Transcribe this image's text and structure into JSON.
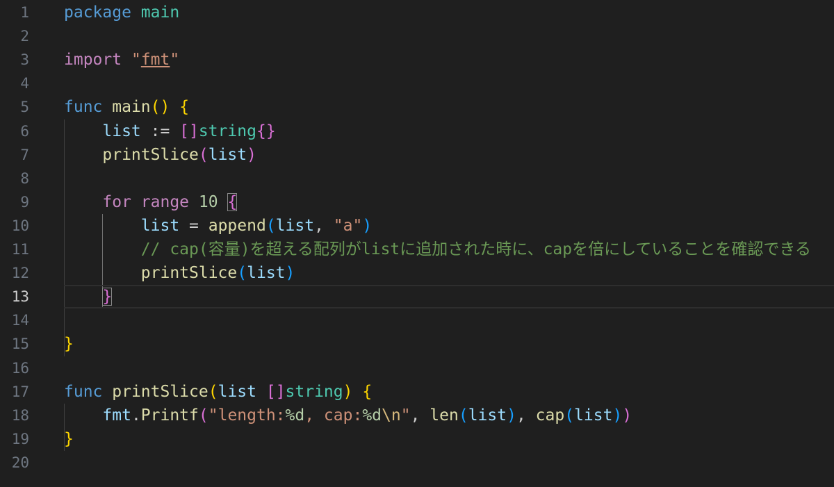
{
  "editor": {
    "language": "go",
    "current_line": 13,
    "line_numbers": [
      "1",
      "2",
      "3",
      "4",
      "5",
      "6",
      "7",
      "8",
      "9",
      "10",
      "11",
      "12",
      "13",
      "14",
      "15",
      "16",
      "17",
      "18",
      "19",
      "20"
    ],
    "lines": [
      [
        [
          "kw",
          "package"
        ],
        [
          "plain",
          " "
        ],
        [
          "type",
          "main"
        ]
      ],
      [],
      [
        [
          "kw2",
          "import"
        ],
        [
          "plain",
          " "
        ],
        [
          "str",
          "\""
        ],
        [
          "str-u",
          "fmt"
        ],
        [
          "str",
          "\""
        ]
      ],
      [],
      [
        [
          "kw",
          "func"
        ],
        [
          "plain",
          " "
        ],
        [
          "fn",
          "main"
        ],
        [
          "b1",
          "()"
        ],
        [
          "plain",
          " "
        ],
        [
          "b1",
          "{"
        ]
      ],
      [
        [
          "plain",
          "    "
        ],
        [
          "var",
          "list"
        ],
        [
          "plain",
          " := "
        ],
        [
          "b2",
          "[]"
        ],
        [
          "type",
          "string"
        ],
        [
          "b2",
          "{}"
        ]
      ],
      [
        [
          "plain",
          "    "
        ],
        [
          "fn",
          "printSlice"
        ],
        [
          "b2",
          "("
        ],
        [
          "var",
          "list"
        ],
        [
          "b2",
          ")"
        ]
      ],
      [],
      [
        [
          "plain",
          "    "
        ],
        [
          "kw2",
          "for"
        ],
        [
          "plain",
          " "
        ],
        [
          "kw2",
          "range"
        ],
        [
          "plain",
          " "
        ],
        [
          "num",
          "10"
        ],
        [
          "plain",
          " "
        ],
        [
          "b2m",
          "{"
        ]
      ],
      [
        [
          "plain",
          "        "
        ],
        [
          "var",
          "list"
        ],
        [
          "plain",
          " = "
        ],
        [
          "fn",
          "append"
        ],
        [
          "b3",
          "("
        ],
        [
          "var",
          "list"
        ],
        [
          "plain",
          ", "
        ],
        [
          "str",
          "\"a\""
        ],
        [
          "b3",
          ")"
        ]
      ],
      [
        [
          "plain",
          "        "
        ],
        [
          "cmt",
          "// cap(容量)を超える配列がlistに追加された時に、capを倍にしていることを確認できる"
        ]
      ],
      [
        [
          "plain",
          "        "
        ],
        [
          "fn",
          "printSlice"
        ],
        [
          "b3",
          "("
        ],
        [
          "var",
          "list"
        ],
        [
          "b3",
          ")"
        ]
      ],
      [
        [
          "plain",
          "    "
        ],
        [
          "b2m",
          "}"
        ]
      ],
      [],
      [
        [
          "b1",
          "}"
        ]
      ],
      [],
      [
        [
          "kw",
          "func"
        ],
        [
          "plain",
          " "
        ],
        [
          "fn",
          "printSlice"
        ],
        [
          "b1",
          "("
        ],
        [
          "var",
          "list"
        ],
        [
          "plain",
          " "
        ],
        [
          "b2",
          "[]"
        ],
        [
          "type",
          "string"
        ],
        [
          "b1",
          ")"
        ],
        [
          "plain",
          " "
        ],
        [
          "b1",
          "{"
        ]
      ],
      [
        [
          "plain",
          "    "
        ],
        [
          "var",
          "fmt"
        ],
        [
          "plain",
          "."
        ],
        [
          "fn",
          "Printf"
        ],
        [
          "b2",
          "("
        ],
        [
          "str",
          "\"length:"
        ],
        [
          "num",
          "%d"
        ],
        [
          "str",
          ", cap:"
        ],
        [
          "num",
          "%d"
        ],
        [
          "esc",
          "\\n"
        ],
        [
          "str",
          "\""
        ],
        [
          "plain",
          ", "
        ],
        [
          "fn",
          "len"
        ],
        [
          "b3",
          "("
        ],
        [
          "var",
          "list"
        ],
        [
          "b3",
          ")"
        ],
        [
          "plain",
          ", "
        ],
        [
          "fn",
          "cap"
        ],
        [
          "b3",
          "("
        ],
        [
          "var",
          "list"
        ],
        [
          "b3",
          ")"
        ],
        [
          "b2",
          ")"
        ]
      ],
      [
        [
          "b1",
          "}"
        ]
      ],
      []
    ]
  },
  "colors": {
    "background": "#1f1f1f",
    "line_number": "#6e7681",
    "keyword": "#569cd6",
    "control_keyword": "#c586c0",
    "function": "#dcdcaa",
    "variable": "#9cdcfe",
    "type": "#4ec9b0",
    "string": "#ce9178",
    "number": "#b5cea8",
    "comment": "#6a9955",
    "bracket_level_1": "#ffd700",
    "bracket_level_2": "#da70d6",
    "bracket_level_3": "#179fff"
  }
}
